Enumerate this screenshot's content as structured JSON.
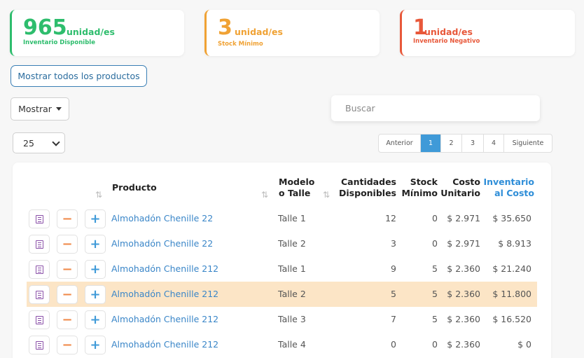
{
  "cards": {
    "inventory": {
      "value": "965",
      "unit": "unidad/es",
      "label": "Inventario Disponible",
      "color": "#2ebd6d"
    },
    "stock_min": {
      "value": "3",
      "unit": "unidad/es",
      "label": "Stock Mínimo",
      "color": "#f0a234"
    },
    "negative": {
      "value": "1",
      "unit": "unidad/es",
      "label": "Inventario Negativo",
      "color": "#e8583a"
    }
  },
  "toolbar": {
    "show_all_label": "Mostrar todos los productos",
    "mostrar_label": "Mostrar",
    "search_placeholder": "Buscar",
    "per_page": "25"
  },
  "pagination": {
    "prev": "Anterior",
    "pages": [
      "1",
      "2",
      "3",
      "4"
    ],
    "active": "1",
    "next": "Siguiente"
  },
  "table": {
    "headers": {
      "product": "Producto",
      "model_line1": "Modelo",
      "model_line2": "o Talle",
      "qty_line1": "Cantidades",
      "qty_line2": "Disponibles",
      "stock_line1": "Stock",
      "stock_line2": "Mínimo",
      "cost_line1": "Costo",
      "cost_line2": "Unitario",
      "inv_line1": "Inventario",
      "inv_line2": "al Costo"
    },
    "rows": [
      {
        "product": "Almohadón Chenille 22",
        "model": "Talle 1",
        "qty": "12",
        "stock_min": "0",
        "cost": "$ 2.971",
        "inv_cost": "$ 35.650"
      },
      {
        "product": "Almohadón Chenille 22",
        "model": "Talle 2",
        "qty": "3",
        "stock_min": "0",
        "cost": "$ 2.971",
        "inv_cost": "$ 8.913"
      },
      {
        "product": "Almohadón Chenille 212",
        "model": "Talle 1",
        "qty": "9",
        "stock_min": "5",
        "cost": "$ 2.360",
        "inv_cost": "$ 21.240"
      },
      {
        "product": "Almohadón Chenille 212",
        "model": "Talle 2",
        "qty": "5",
        "stock_min": "5",
        "cost": "$ 2.360",
        "inv_cost": "$ 11.800"
      },
      {
        "product": "Almohadón Chenille 212",
        "model": "Talle 3",
        "qty": "7",
        "stock_min": "5",
        "cost": "$ 2.360",
        "inv_cost": "$ 16.520"
      },
      {
        "product": "Almohadón Chenille 212",
        "model": "Talle 4",
        "qty": "0",
        "stock_min": "0",
        "cost": "$ 2.360",
        "inv_cost": "$ 0"
      }
    ]
  }
}
